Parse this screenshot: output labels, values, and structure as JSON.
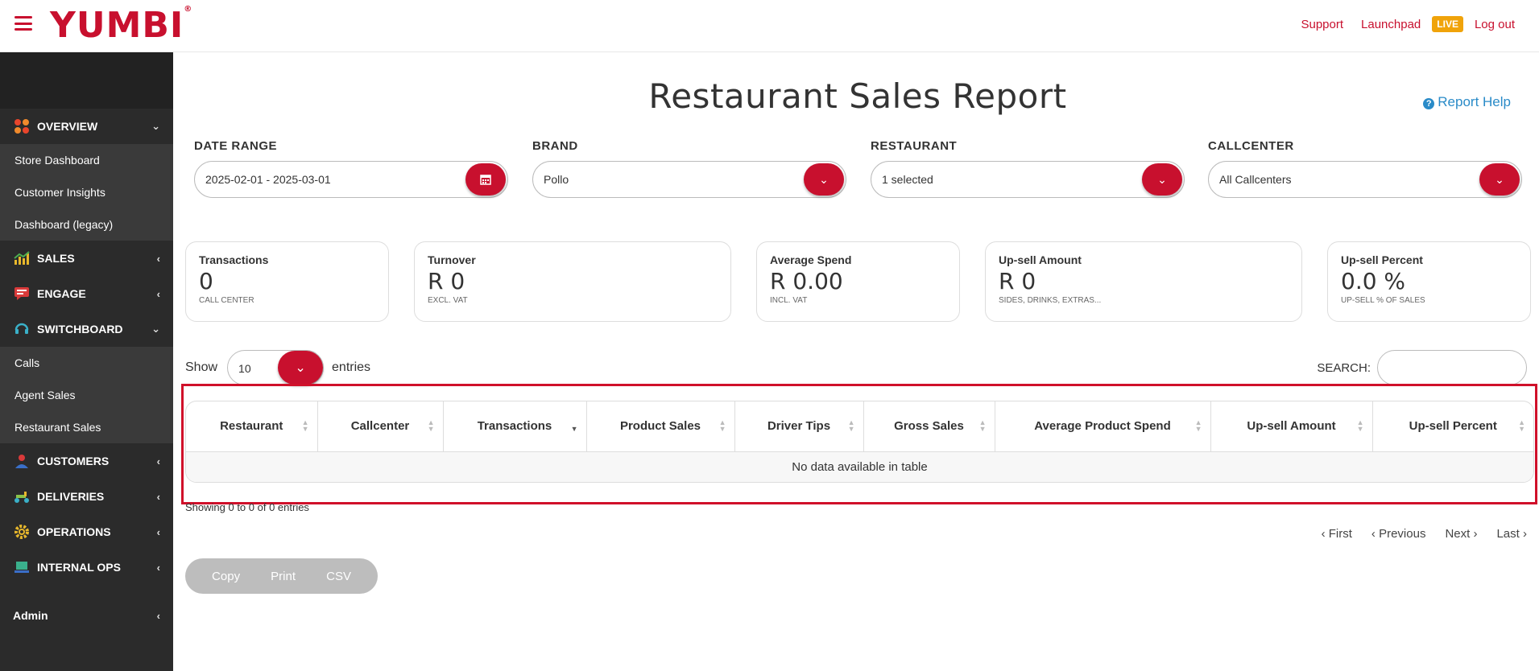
{
  "header": {
    "logo": "YUMBI",
    "links": {
      "support": "Support",
      "launchpad": "Launchpad",
      "live": "LIVE",
      "logout": "Log out"
    }
  },
  "sidebar": {
    "overview": {
      "label": "OVERVIEW",
      "items": [
        "Store Dashboard",
        "Customer Insights",
        "Dashboard (legacy)"
      ]
    },
    "sales": "SALES",
    "engage": "ENGAGE",
    "switchboard": {
      "label": "SWITCHBOARD",
      "items": [
        "Calls",
        "Agent Sales",
        "Restaurant Sales"
      ]
    },
    "customers": "CUSTOMERS",
    "deliveries": "DELIVERIES",
    "operations": "OPERATIONS",
    "internal_ops": "INTERNAL OPS",
    "admin": "Admin"
  },
  "page": {
    "title": "Restaurant Sales Report",
    "help": "Report Help"
  },
  "filters": {
    "date_range": {
      "label": "DATE RANGE",
      "value": "2025-02-01 - 2025-03-01"
    },
    "brand": {
      "label": "BRAND",
      "value": "Pollo"
    },
    "restaurant": {
      "label": "RESTAURANT",
      "value": "1 selected"
    },
    "callcenter": {
      "label": "CALLCENTER",
      "value": "All Callcenters"
    }
  },
  "stats": {
    "transactions": {
      "title": "Transactions",
      "value": "0",
      "sub": "CALL CENTER"
    },
    "turnover": {
      "title": "Turnover",
      "value": "R 0",
      "sub": "EXCL. VAT"
    },
    "avg_spend": {
      "title": "Average Spend",
      "value": "R 0.00",
      "sub": "INCL. VAT"
    },
    "upsell_amount": {
      "title": "Up-sell Amount",
      "value": "R 0",
      "sub": "SIDES, DRINKS, EXTRAS..."
    },
    "upsell_percent": {
      "title": "Up-sell Percent",
      "value": "0.0 %",
      "sub": "UP-SELL % OF SALES"
    }
  },
  "table_controls": {
    "show": "Show",
    "entries_value": "10",
    "entries": "entries",
    "search_label": "SEARCH:"
  },
  "table": {
    "columns": [
      "Restaurant",
      "Callcenter",
      "Transactions",
      "Product Sales",
      "Driver Tips",
      "Gross Sales",
      "Average Product Spend",
      "Up-sell Amount",
      "Up-sell Percent"
    ],
    "empty": "No data available in table",
    "showing": "Showing 0 to 0 of 0 entries"
  },
  "pager": {
    "first": "First",
    "previous": "Previous",
    "next": "Next",
    "last": "Last"
  },
  "export": {
    "copy": "Copy",
    "print": "Print",
    "csv": "CSV"
  },
  "colors": {
    "brand_red": "#c8102e",
    "sidebar": "#2b2b2b",
    "live": "#f0a30a",
    "help": "#2a8bc8"
  }
}
